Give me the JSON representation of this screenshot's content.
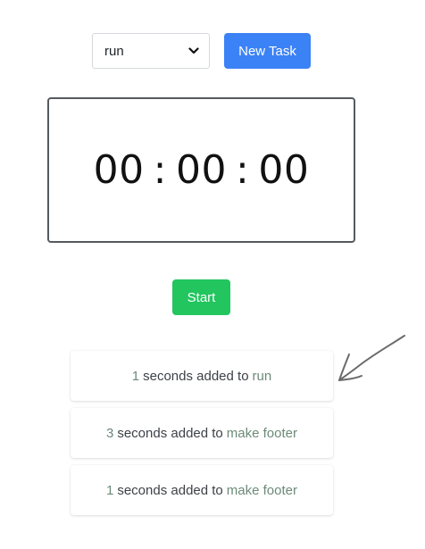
{
  "controls": {
    "task_select": {
      "selected": "run",
      "icon": "chevron-down-icon"
    },
    "new_task_label": "New Task"
  },
  "timer": {
    "hours": "00",
    "minutes": "00",
    "seconds": "00",
    "separator": ":"
  },
  "start_label": "Start",
  "log": [
    {
      "amount": "1",
      "text": "seconds added to",
      "task": "run"
    },
    {
      "amount": "3",
      "text": "seconds added to",
      "task": "make footer"
    },
    {
      "amount": "1",
      "text": "seconds added to",
      "task": "make footer"
    }
  ],
  "annotation_icon": "hand-drawn-arrow-icon",
  "colors": {
    "new_task_button": "#3b82f6",
    "start_button": "#22c55e",
    "timer_border": "#555a5f",
    "accent_text": "#6c8a78"
  }
}
